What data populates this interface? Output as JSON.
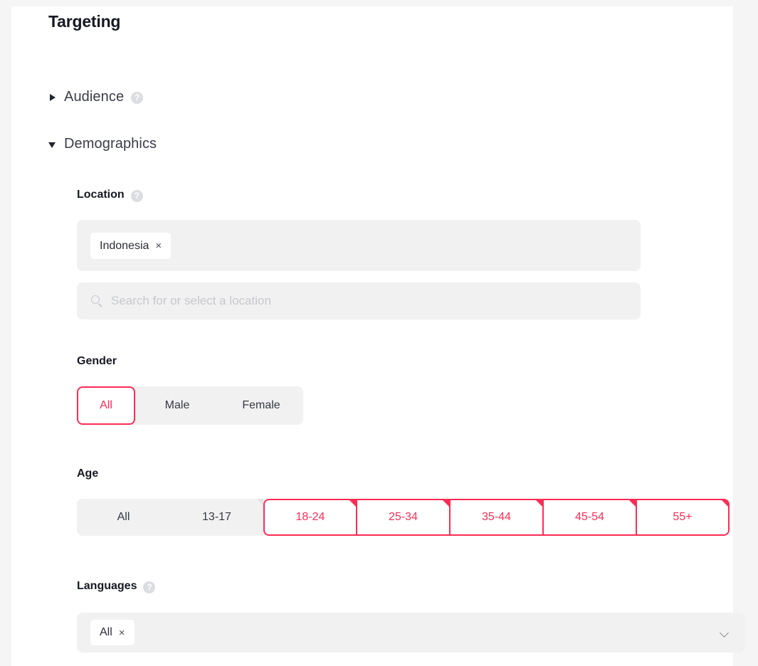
{
  "page": {
    "title": "Targeting"
  },
  "accordions": [
    {
      "label": "Audience",
      "state": "collapsed",
      "has_help": true
    },
    {
      "label": "Demographics",
      "state": "expanded",
      "has_help": false
    }
  ],
  "location": {
    "label": "Location",
    "has_help": true,
    "chips": [
      {
        "text": "Indonesia",
        "remove": "×"
      }
    ],
    "search_placeholder": "Search for or select a location",
    "search_value": ""
  },
  "gender": {
    "label": "Gender",
    "has_help": false,
    "options": [
      {
        "label": "All",
        "selected": true
      },
      {
        "label": "Male",
        "selected": false
      },
      {
        "label": "Female",
        "selected": false
      }
    ],
    "selected": "All"
  },
  "age": {
    "label": "Age",
    "has_help": false,
    "options": [
      {
        "label": "All",
        "selected": false
      },
      {
        "label": "13-17",
        "selected": false
      },
      {
        "label": "18-24",
        "selected": true
      },
      {
        "label": "25-34",
        "selected": true
      },
      {
        "label": "35-44",
        "selected": true
      },
      {
        "label": "45-54",
        "selected": true
      },
      {
        "label": "55+",
        "selected": true
      }
    ],
    "selected": [
      "18-24",
      "25-34",
      "35-44",
      "45-54",
      "55+"
    ]
  },
  "languages": {
    "label": "Languages",
    "has_help": true,
    "chips": [
      {
        "text": "All",
        "remove": "×"
      }
    ],
    "dropdown_icon": "chevron-down-icon"
  },
  "icons": {
    "help": "?",
    "caret_right": "caret-right-icon",
    "caret_down": "caret-down-icon",
    "search": "search-icon"
  },
  "colors": {
    "accent": "#fe2c55",
    "field_bg": "#f1f1f2",
    "card_bg": "#ffffff",
    "page_bg": "#f5f5f5",
    "text": "#161823"
  }
}
